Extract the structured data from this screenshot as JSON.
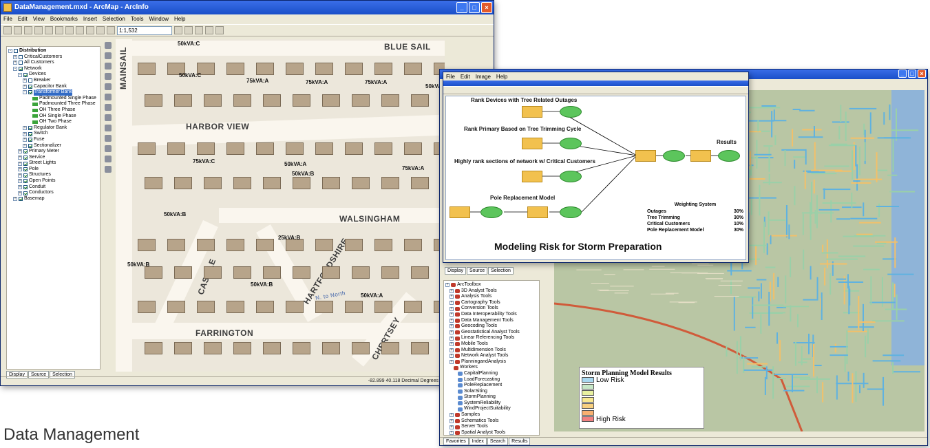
{
  "caption": "Data Management",
  "arcmap": {
    "title": "DataManagement.mxd - ArcMap - ArcInfo",
    "menus": [
      "File",
      "Edit",
      "View",
      "Bookmarks",
      "Insert",
      "Selection",
      "Tools",
      "Window",
      "Help"
    ],
    "scale": "1:1,532",
    "toc": [
      {
        "label": "Distribution",
        "indent": 0,
        "pm": "-",
        "check": false,
        "bold": true
      },
      {
        "label": "CriticalCustomers",
        "indent": 1,
        "pm": "+",
        "check": false
      },
      {
        "label": "All Customers",
        "indent": 1,
        "pm": "+",
        "check": false
      },
      {
        "label": "Network",
        "indent": 1,
        "pm": "-",
        "check": true
      },
      {
        "label": "Devices",
        "indent": 2,
        "pm": "-",
        "check": true
      },
      {
        "label": "Breaker",
        "indent": 3,
        "pm": "+",
        "check": false
      },
      {
        "label": "Capacitor Bank",
        "indent": 3,
        "pm": "+",
        "check": true
      },
      {
        "label": "Transformer Bank",
        "indent": 3,
        "pm": "-",
        "check": true,
        "selected": true
      },
      {
        "label": "Padmounted Single Phase",
        "indent": 5,
        "pm": "",
        "check": null
      },
      {
        "label": "Padmounted Three Phase",
        "indent": 5,
        "pm": "",
        "check": null
      },
      {
        "label": "OH Three Phase",
        "indent": 5,
        "pm": "",
        "check": null
      },
      {
        "label": "OH Single Phase",
        "indent": 5,
        "pm": "",
        "check": null
      },
      {
        "label": "OH Two Phase",
        "indent": 5,
        "pm": "",
        "check": null
      },
      {
        "label": "Regulator Bank",
        "indent": 3,
        "pm": "+",
        "check": true
      },
      {
        "label": "Switch",
        "indent": 3,
        "pm": "+",
        "check": true
      },
      {
        "label": "Fuse",
        "indent": 3,
        "pm": "+",
        "check": true
      },
      {
        "label": "Sectionalizer",
        "indent": 3,
        "pm": "+",
        "check": true
      },
      {
        "label": "Primary Meter",
        "indent": 2,
        "pm": "+",
        "check": true
      },
      {
        "label": "Service",
        "indent": 2,
        "pm": "+",
        "check": true
      },
      {
        "label": "Street Lights",
        "indent": 2,
        "pm": "+",
        "check": true
      },
      {
        "label": "Pole",
        "indent": 2,
        "pm": "+",
        "check": true
      },
      {
        "label": "Structures",
        "indent": 2,
        "pm": "+",
        "check": true
      },
      {
        "label": "Open Points",
        "indent": 2,
        "pm": "+",
        "check": true
      },
      {
        "label": "Conduit",
        "indent": 2,
        "pm": "+",
        "check": true
      },
      {
        "label": "Conductors",
        "indent": 2,
        "pm": "+",
        "check": true
      },
      {
        "label": "Basemap",
        "indent": 1,
        "pm": "+",
        "check": true
      }
    ],
    "tabs": [
      "Display",
      "Source",
      "Selection"
    ],
    "streets": {
      "mainsail": "MAINSAIL",
      "blue_sail": "BLUE SAIL",
      "harbor_view": "HARBOR VIEW",
      "walsingham": "WALSINGHAM",
      "castile": "CASTILE",
      "hartfordshire": "HARTFORDSHIRE",
      "farrington": "FARRINGTON",
      "chertsey": "CHERTSEY",
      "n_to_north": "N. to North"
    },
    "transformers": [
      "50kVA:C",
      "50kVA:C",
      "75kVA:A",
      "75kVA:A",
      "75kVA:A",
      "50kVA:",
      "75kVA:C",
      "50kVA:A",
      "50kVA:B",
      "75kVA:A",
      "50kVA:B",
      "25kVA:B",
      "50kVA:B",
      "50kVA:B",
      "50kVA:A"
    ],
    "status": "-82.899  40.118 Decimal Degrees"
  },
  "model": {
    "menus": [
      "File",
      "Edit",
      "Image",
      "Help"
    ],
    "headings": {
      "h1": "Rank Devices with Tree Related Outages",
      "h2": "Rank Primary Based on Tree Trimming Cycle",
      "h3": "Highly rank sections of network w/ Critical Customers",
      "h4": "Pole Replacement Model",
      "results": "Results"
    },
    "weighting_title": "Weighting System",
    "weights": [
      {
        "name": "Outages",
        "value": "30%"
      },
      {
        "name": "Tree Trimming",
        "value": "30%"
      },
      {
        "name": "Critical Customers",
        "value": "10%"
      },
      {
        "name": "Pole Replacement Model",
        "value": "30%"
      }
    ],
    "footer_title": "Modeling Risk for Storm Preparation"
  },
  "arctoolbox": {
    "tabs_top": [
      "Display",
      "Source",
      "Selection"
    ],
    "items": [
      {
        "label": "ArcToolbox",
        "indent": 0
      },
      {
        "label": "3D Analyst Tools",
        "indent": 1
      },
      {
        "label": "Analysis Tools",
        "indent": 1
      },
      {
        "label": "Cartography Tools",
        "indent": 1
      },
      {
        "label": "Conversion Tools",
        "indent": 1
      },
      {
        "label": "Data Interoperability Tools",
        "indent": 1
      },
      {
        "label": "Data Management Tools",
        "indent": 1
      },
      {
        "label": "Geocoding Tools",
        "indent": 1
      },
      {
        "label": "Geostatistical Analyst Tools",
        "indent": 1
      },
      {
        "label": "Linear Referencing Tools",
        "indent": 1
      },
      {
        "label": "Mobile Tools",
        "indent": 1
      },
      {
        "label": "Multidimension Tools",
        "indent": 1
      },
      {
        "label": "Network Analyst Tools",
        "indent": 1
      },
      {
        "label": "PlanningandAnalysis",
        "indent": 1
      },
      {
        "label": "Workers",
        "indent": 2
      },
      {
        "label": "CapitalPlanning",
        "indent": 3
      },
      {
        "label": "LoadForecasting",
        "indent": 3
      },
      {
        "label": "PoleReplacement",
        "indent": 3
      },
      {
        "label": "SolarSiting",
        "indent": 3
      },
      {
        "label": "StormPlanning",
        "indent": 3
      },
      {
        "label": "SystemReliability",
        "indent": 3
      },
      {
        "label": "WindProjectSuitability",
        "indent": 3
      },
      {
        "label": "Samples",
        "indent": 1
      },
      {
        "label": "Schematics Tools",
        "indent": 1
      },
      {
        "label": "Server Tools",
        "indent": 1
      },
      {
        "label": "Spatial Analyst Tools",
        "indent": 1
      }
    ],
    "tabs_bottom": [
      "Favorites",
      "Index",
      "Search",
      "Results"
    ]
  },
  "risk_map": {
    "legend_title": "Storm Planning Model Results",
    "low": "Low Risk",
    "high": "High Risk",
    "colors": [
      "#a8d8f0",
      "#c8e8c8",
      "#e8f0a0",
      "#f8e890",
      "#f8d080",
      "#f8b070",
      "#f08080"
    ]
  }
}
